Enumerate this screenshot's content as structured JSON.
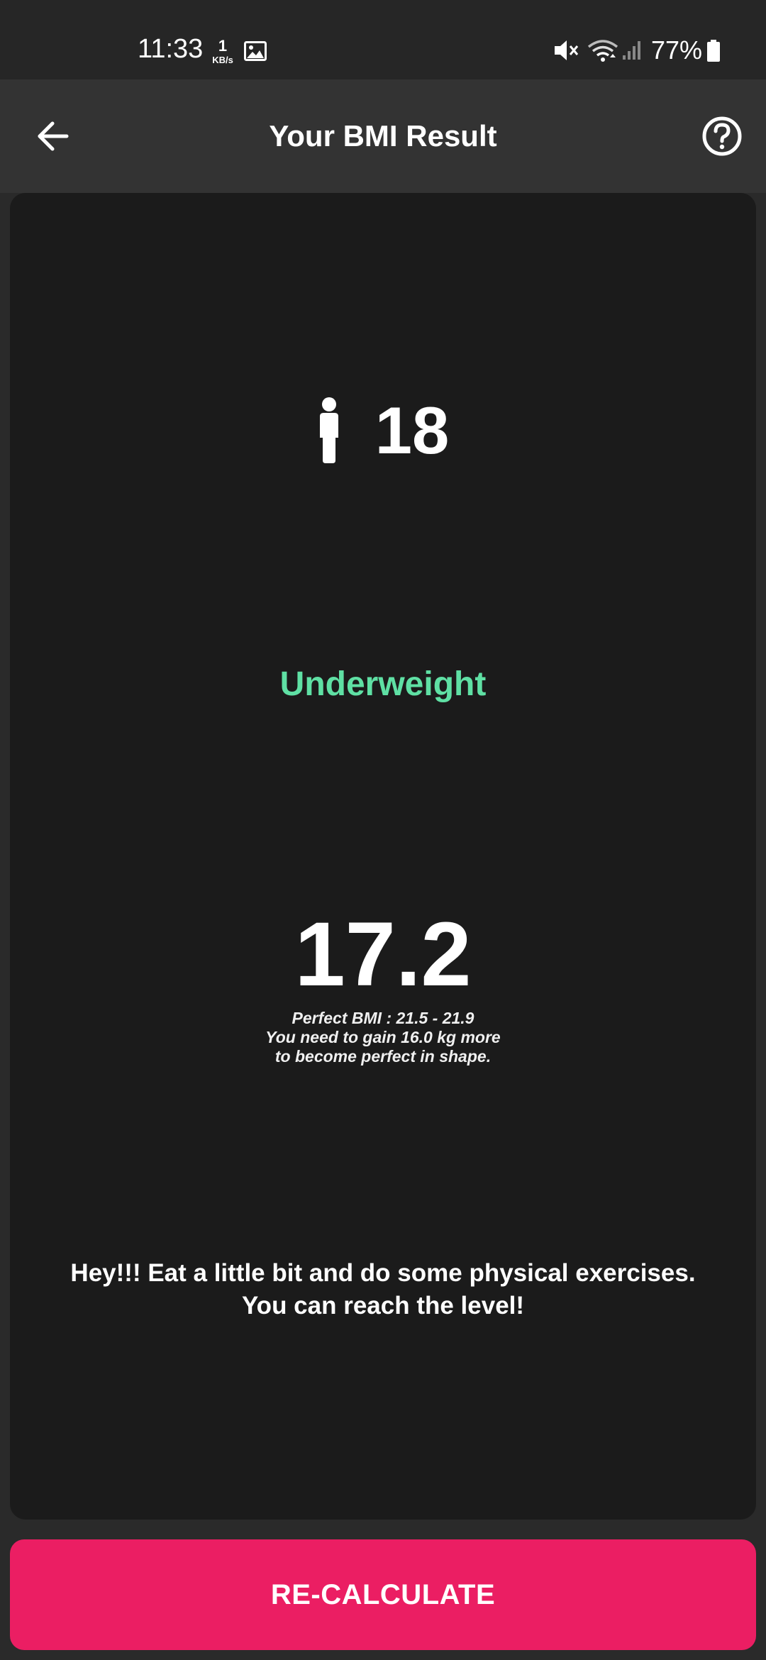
{
  "status_bar": {
    "time": "11:33",
    "net_speed_value": "1",
    "net_speed_unit": "KB/s",
    "battery": "77%",
    "icons": [
      "gallery-icon",
      "mute-icon",
      "wifi-icon",
      "signal-icon",
      "battery-icon"
    ]
  },
  "app_bar": {
    "title": "Your BMI Result",
    "back_icon": "arrow-left-icon",
    "help_icon": "help-circle-icon"
  },
  "result": {
    "person_icon": "person-icon",
    "age": "18",
    "category": "Underweight",
    "category_color": "#5fe0a4",
    "bmi": "17.2",
    "note_lines": [
      "Perfect BMI : 21.5 - 21.9",
      "You need to gain 16.0 kg more",
      "to become perfect in shape."
    ],
    "advice_lines": [
      "Hey!!! Eat a little bit and do some physical exercises.",
      "You can reach the level!"
    ]
  },
  "actions": {
    "recalculate_label": "RE-CALCULATE",
    "recalculate_color": "#eb1e63"
  }
}
